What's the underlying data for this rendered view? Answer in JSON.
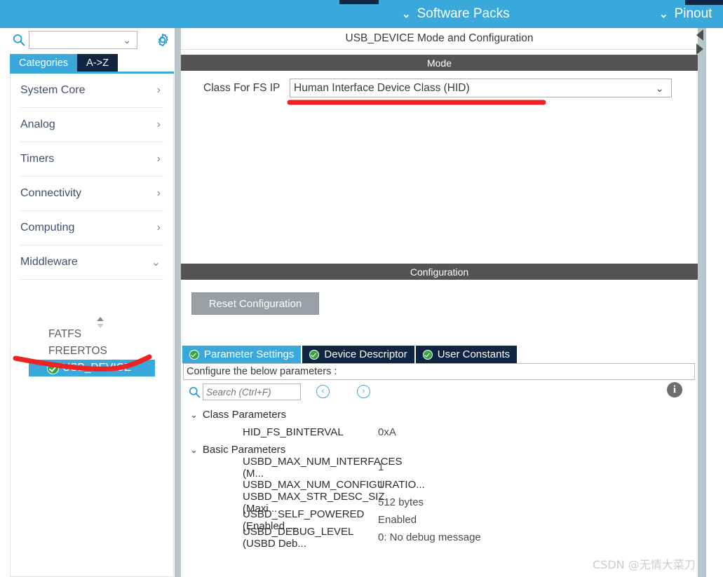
{
  "topbar": {
    "items": [
      {
        "label": "Software Packs",
        "icon": "chevron-down-icon",
        "chevron": "⌄"
      },
      {
        "label": "Pinout",
        "icon": "chevron-down-icon",
        "chevron": "⌄"
      }
    ],
    "accent_color": "#39a9dc"
  },
  "sidebar": {
    "search": {
      "value": "",
      "placeholder": "",
      "icon": "search-icon",
      "chevron": "⌄"
    },
    "settings_icon": "gear-icon",
    "tabs": [
      {
        "label": "Categories",
        "active": true
      },
      {
        "label": "A->Z",
        "active": false
      }
    ],
    "categories": [
      {
        "label": "System Core",
        "chevron": "›",
        "expanded": false
      },
      {
        "label": "Analog",
        "chevron": "›",
        "expanded": false
      },
      {
        "label": "Timers",
        "chevron": "›",
        "expanded": false
      },
      {
        "label": "Connectivity",
        "chevron": "›",
        "expanded": false
      },
      {
        "label": "Computing",
        "chevron": "›",
        "expanded": false
      },
      {
        "label": "Middleware",
        "chevron": "⌄",
        "expanded": true
      }
    ],
    "middleware_items": [
      {
        "label": "FATFS",
        "selected": false,
        "status_icon": ""
      },
      {
        "label": "FREERTOS",
        "selected": false,
        "status_icon": ""
      },
      {
        "label": "USB_DEVICE",
        "selected": true,
        "status_icon": "green-check-icon"
      }
    ],
    "selected_highlight_color": "#39a9dc"
  },
  "main": {
    "panel_title": "USB_DEVICE Mode and Configuration",
    "mode": {
      "section_label": "Mode",
      "class_label": "Class For FS IP",
      "class_value": "Human Interface Device Class (HID)",
      "class_chevron": "⌄"
    },
    "configuration": {
      "section_label": "Configuration",
      "reset_button": "Reset Configuration",
      "tabs": [
        {
          "label": "Parameter Settings",
          "active": true,
          "icon": "green-check-icon"
        },
        {
          "label": "Device Descriptor",
          "active": false,
          "icon": "green-check-icon"
        },
        {
          "label": "User Constants",
          "active": false,
          "icon": "green-check-icon"
        }
      ],
      "configure_hint": "Configure the below parameters :",
      "search": {
        "value": "",
        "placeholder": "Search (Ctrl+F)",
        "icon": "search-icon",
        "prev_icon": "circle-left-arrow-icon",
        "prev_glyph": "‹",
        "next_icon": "circle-right-arrow-icon",
        "next_glyph": "›",
        "info_icon": "info-icon",
        "info_glyph": "i"
      },
      "groups": [
        {
          "label": "Class Parameters",
          "chevron": "⌄",
          "rows": [
            {
              "name": "HID_FS_BINTERVAL",
              "value": "0xA"
            }
          ]
        },
        {
          "label": "Basic Parameters",
          "chevron": "⌄",
          "rows": [
            {
              "name": "USBD_MAX_NUM_INTERFACES (M...",
              "value": "1"
            },
            {
              "name": "USBD_MAX_NUM_CONFIGURATIO...",
              "value": "1"
            },
            {
              "name": "USBD_MAX_STR_DESC_SIZ (Maxi...",
              "value": "512 bytes"
            },
            {
              "name": "USBD_SELF_POWERED (Enabled ...",
              "value": "Enabled"
            },
            {
              "name": "USBD_DEBUG_LEVEL (USBD Deb...",
              "value": "0: No debug message"
            }
          ]
        }
      ]
    }
  },
  "scrollbar": {
    "left_arrow_icon": "triangle-left-icon",
    "right_arrow_icon": "triangle-right-icon"
  },
  "annotations": {
    "color": "#ee2222",
    "underline_class_field": "red-underline-under-class-dropdown",
    "curve_usb_device": "red-curve-under-usb-device"
  },
  "watermark": "CSDN @无情大菜刀"
}
